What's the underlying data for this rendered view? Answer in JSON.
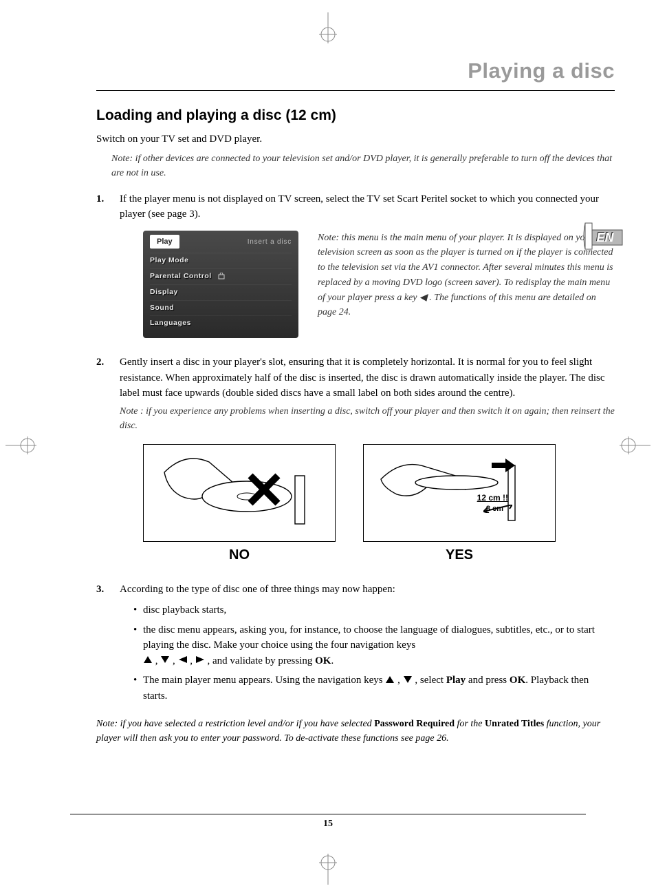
{
  "chapter_title": "Playing a disc",
  "section_heading": "Loading and playing a disc (12 cm)",
  "intro_line": "Switch on your TV set and DVD player.",
  "intro_note": "Note: if other devices are connected to your television set and/or DVD player, it is generally preferable to turn off the devices that are not in use.",
  "lang_badge": "EN",
  "step1": "If the player menu is not displayed on TV screen, select the TV set Scart Peritel socket to which you connected your player (see page 3).",
  "player_menu": {
    "selected": "Play",
    "prompt": "Insert a disc",
    "items": [
      "Play Mode",
      "Parental Control",
      "Display",
      "Sound",
      "Languages"
    ]
  },
  "step1_note": "Note: this menu is the main menu of your player. It is displayed on your television screen as soon as the player is turned on if the player is connected to the television set via the AV1 connector. After several minutes this menu is replaced by a moving DVD logo (screen saver). To redisplay the main menu of your player press a key  ◀ . The functions of this menu are detailed on page 24.",
  "step2": "Gently insert a disc in your player's slot, ensuring that it is completely horizontal. It is normal for you to feel slight resistance. When approximately half of the disc is inserted, the disc is drawn automatically inside the player. The disc label must face upwards (double sided discs have a small label on both sides around the centre).",
  "step2_note": "Note : if you experience any problems when inserting a disc, switch off your player and then switch it on again; then reinsert the disc.",
  "fig_no": "NO",
  "fig_yes": "YES",
  "fig_size_good": "12 cm !!",
  "fig_size_bad": "8 cm",
  "step3_intro": "According to the type of disc one of three things may now happen:",
  "step3_bullets": {
    "b1": "disc playback starts,",
    "b2_a": "the disc menu appears, asking you, for instance, to choose the language of dialogues, subtitles, etc., or to start playing the disc. Make your choice using the four navigation keys",
    "b2_b": ", and validate by pressing ",
    "b2_ok": "OK",
    "b3_a": "The main player menu appears. Using the navigation keys ",
    "b3_b": ", select ",
    "b3_play": "Play",
    "b3_c": " and press ",
    "b3_ok": "OK",
    "b3_d": ". Playback then starts."
  },
  "final_note": {
    "a": "Note: if you have selected a restriction level and/or if you have selected ",
    "pw": "Password Required",
    "b": " for the ",
    "ut": "Unrated Titles",
    "c": " function, your player will then ask you to enter your password. To de-activate these functions see page 26."
  },
  "page_number": "15"
}
